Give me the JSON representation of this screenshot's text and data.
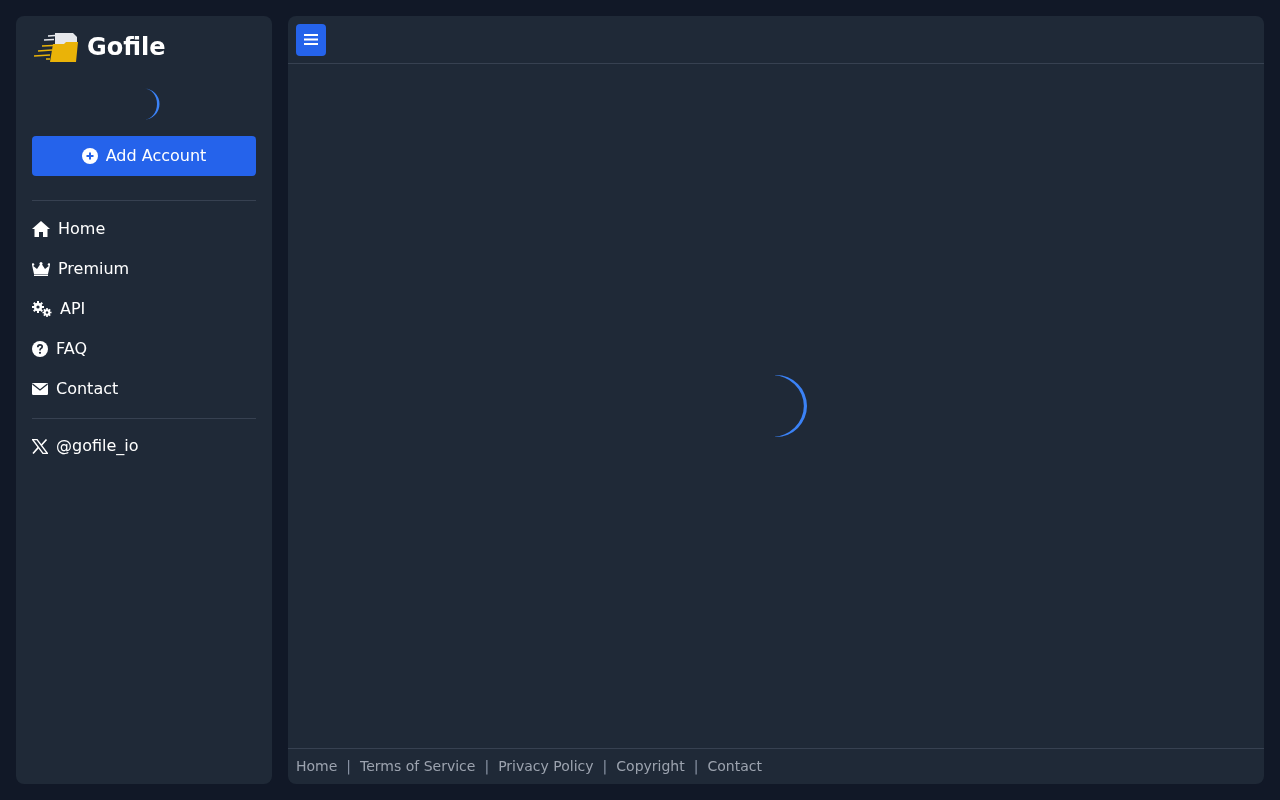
{
  "sidebar": {
    "brand": "Gofile",
    "add_account_button": "Add Account",
    "nav_items": [
      {
        "label": "Home"
      },
      {
        "label": "Premium"
      },
      {
        "label": "API"
      },
      {
        "label": "FAQ"
      },
      {
        "label": "Contact"
      }
    ],
    "social_link": {
      "label": "@gofile_io"
    }
  },
  "footer": {
    "items": [
      {
        "kind": "link",
        "label": "Home"
      },
      {
        "kind": "separator",
        "label": "|"
      },
      {
        "kind": "link",
        "label": "Terms of Service"
      },
      {
        "kind": "separator",
        "label": "|"
      },
      {
        "kind": "link",
        "label": "Privacy Policy"
      },
      {
        "kind": "separator",
        "label": "|"
      },
      {
        "kind": "link",
        "label": "Copyright"
      },
      {
        "kind": "separator",
        "label": "|"
      },
      {
        "kind": "link",
        "label": "Contact"
      }
    ]
  }
}
